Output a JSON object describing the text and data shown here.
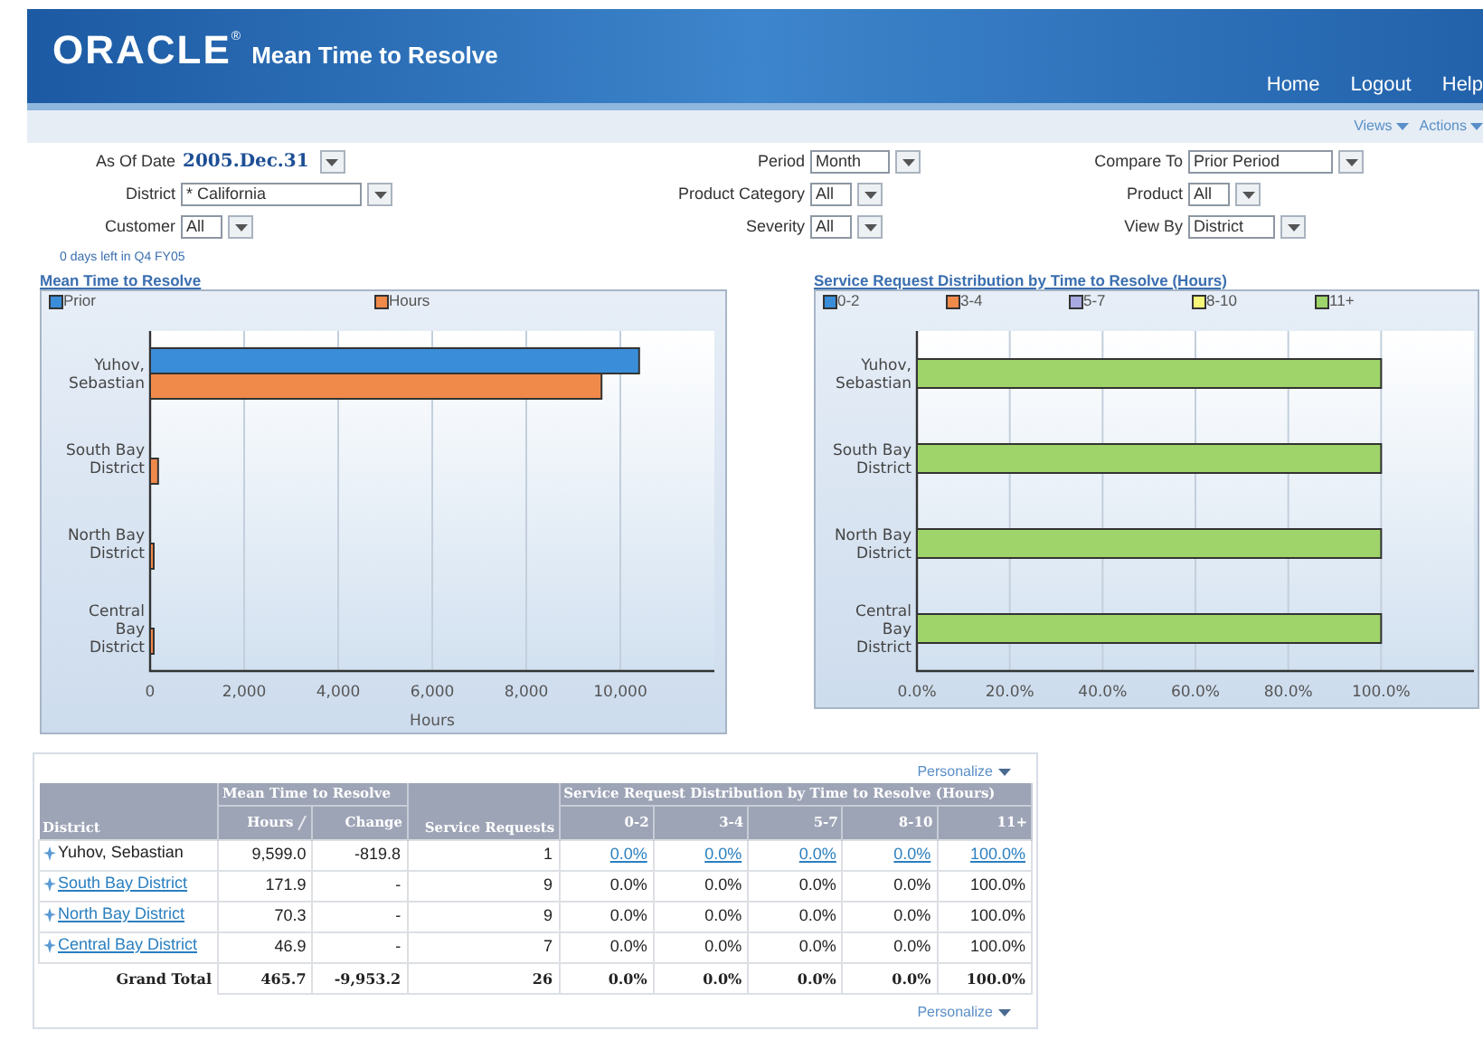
{
  "header": {
    "logo": "ORACLE",
    "logo_mark": "®",
    "title": "Mean Time to Resolve",
    "nav": [
      "Home",
      "Logout",
      "Help"
    ]
  },
  "toolbar": [
    {
      "label": "Views"
    },
    {
      "label": "Actions"
    }
  ],
  "parameters": [
    {
      "label": "As Of Date",
      "value": "2005.Dec.31",
      "kind": "date"
    },
    {
      "label": "Period",
      "value": "Month",
      "kind": "select"
    },
    {
      "label": "Compare To",
      "value": "Prior Period",
      "kind": "select"
    },
    {
      "label": "District",
      "value": "* California",
      "kind": "select"
    },
    {
      "label": "Product Category",
      "value": "All",
      "kind": "select"
    },
    {
      "label": "Product",
      "value": "All",
      "kind": "select"
    },
    {
      "label": "Customer",
      "value": "All",
      "kind": "select"
    },
    {
      "label": "Severity",
      "value": "All",
      "kind": "select"
    },
    {
      "label": "View By",
      "value": "District",
      "kind": "select"
    }
  ],
  "note": "0 days left in Q4 FY05",
  "charts": [
    {
      "chart_data": {
        "type": "bar",
        "orientation": "horizontal",
        "title": "Mean Time to Resolve",
        "xlabel": "Hours",
        "categories": [
          "Yuhov, Sebastian",
          "South Bay District",
          "North Bay District",
          "Central Bay District"
        ],
        "series": [
          {
            "name": "Prior",
            "color": "#3a8dd8",
            "values": [
              10400,
              null,
              null,
              null
            ]
          },
          {
            "name": "Hours",
            "color": "#f08a4b",
            "values": [
              9600,
              170,
              70,
              50
            ]
          }
        ],
        "grid": true,
        "legend": "top",
        "xlim": [
          0,
          12000
        ],
        "xticks": [
          {
            "value": 0,
            "label": "0"
          },
          {
            "value": 2000,
            "label": "2,000"
          },
          {
            "value": 4000,
            "label": "4,000"
          },
          {
            "value": 6000,
            "label": "6,000"
          },
          {
            "value": 8000,
            "label": "8,000"
          },
          {
            "value": 10000,
            "label": "10,000"
          }
        ]
      }
    },
    {
      "chart_data": {
        "type": "bar",
        "orientation": "horizontal",
        "stacked": true,
        "title": "Service Request Distribution by Time to Resolve (Hours)",
        "categories": [
          "Yuhov, Sebastian",
          "South Bay District",
          "North Bay District",
          "Central Bay District"
        ],
        "series": [
          {
            "name": "0-2",
            "color": "#3a8dd8",
            "values": [
              0,
              0,
              0,
              0
            ]
          },
          {
            "name": "3-4",
            "color": "#f08a4b",
            "values": [
              0,
              0,
              0,
              0
            ]
          },
          {
            "name": "5-7",
            "color": "#a9a9e2",
            "values": [
              0,
              0,
              0,
              0
            ]
          },
          {
            "name": "8-10",
            "color": "#f7f77a",
            "values": [
              0,
              0,
              0,
              0
            ]
          },
          {
            "name": "11+",
            "color": "#9ed46a",
            "values": [
              100,
              100,
              100,
              100
            ]
          }
        ],
        "grid": true,
        "legend": "top",
        "xlim": [
          0,
          120
        ],
        "xticks": [
          {
            "value": 0,
            "label": "0.0%"
          },
          {
            "value": 20,
            "label": "20.0%"
          },
          {
            "value": 40,
            "label": "40.0%"
          },
          {
            "value": 60,
            "label": "60.0%"
          },
          {
            "value": 80,
            "label": "80.0%"
          },
          {
            "value": 100,
            "label": "100.0%"
          }
        ]
      }
    }
  ],
  "table": {
    "personalize": [
      "Personalize",
      "Personalize"
    ],
    "columns": [
      {
        "kind": "single",
        "label": "District"
      },
      {
        "kind": "group",
        "label": "Mean Time to Resolve",
        "columns": [
          {
            "label": "Hours",
            "sorted": true
          },
          {
            "label": "Change",
            "sorted": false
          }
        ]
      },
      {
        "kind": "single",
        "label": "Service Requests"
      },
      {
        "kind": "group",
        "label": "Service Request Distribution by Time to Resolve (Hours)",
        "columns": [
          {
            "label": "0-2",
            "sorted": false
          },
          {
            "label": "3-4",
            "sorted": false
          },
          {
            "label": "5-7",
            "sorted": false
          },
          {
            "label": "8-10",
            "sorted": false
          },
          {
            "label": "11+",
            "sorted": false
          }
        ]
      }
    ],
    "rows": [
      {
        "kind": "member",
        "district": "Yuhov, Sebastian",
        "linked": false,
        "values": [
          "9,599.0",
          "-819.8",
          "1"
        ],
        "dist": [
          "0.0%",
          "0.0%",
          "0.0%",
          "0.0%",
          "100.0%"
        ],
        "dist_linked": true
      },
      {
        "kind": "member",
        "district": "South Bay District",
        "linked": true,
        "values": [
          "171.9",
          "-",
          "9"
        ],
        "dist": [
          "0.0%",
          "0.0%",
          "0.0%",
          "0.0%",
          "100.0%"
        ],
        "dist_linked": false
      },
      {
        "kind": "member",
        "district": "North Bay District",
        "linked": true,
        "values": [
          "70.3",
          "-",
          "9"
        ],
        "dist": [
          "0.0%",
          "0.0%",
          "0.0%",
          "0.0%",
          "100.0%"
        ],
        "dist_linked": false
      },
      {
        "kind": "member",
        "district": "Central Bay District",
        "linked": true,
        "values": [
          "46.9",
          "-",
          "7"
        ],
        "dist": [
          "0.0%",
          "0.0%",
          "0.0%",
          "0.0%",
          "100.0%"
        ],
        "dist_linked": false
      },
      {
        "kind": "total",
        "district": "Grand Total",
        "linked": false,
        "values": [
          "465.7",
          "-9,953.2",
          "26"
        ],
        "dist": [
          "0.0%",
          "0.0%",
          "0.0%",
          "0.0%",
          "100.0%"
        ],
        "dist_linked": false
      }
    ]
  }
}
